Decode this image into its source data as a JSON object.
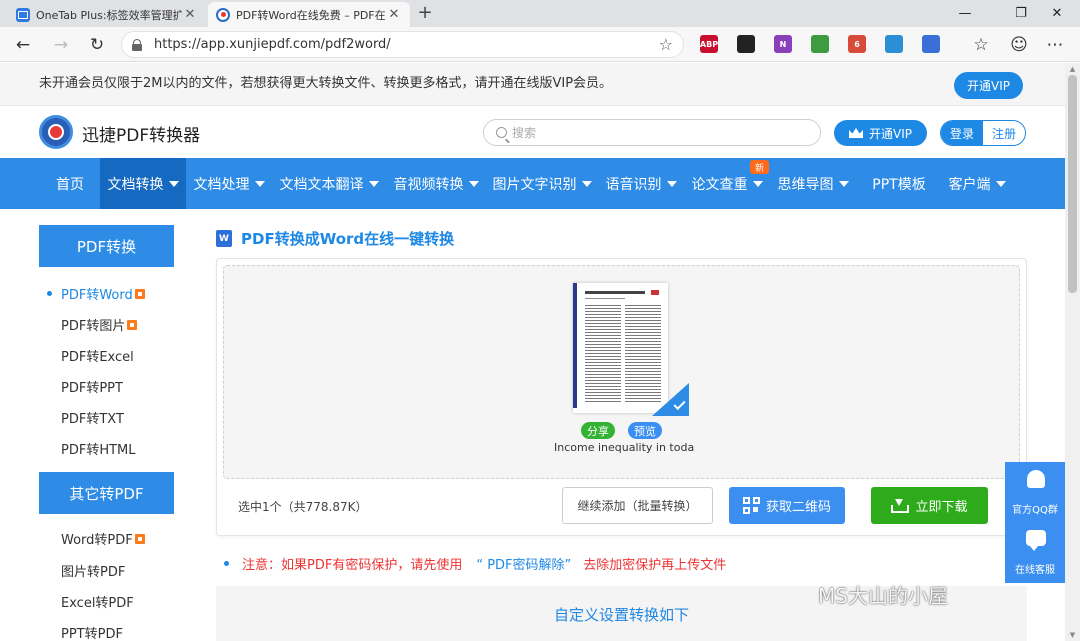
{
  "browser": {
    "tabs": [
      {
        "title": "OneTab Plus:标签效率管理扩展"
      },
      {
        "title": "PDF转Word在线免费 – PDF在线转"
      }
    ],
    "new_tab_symbol": "+",
    "close_symbol": "✕",
    "url": "https://app.xunjiepdf.com/pdf2word/",
    "extensions": [
      {
        "name": "adblock-icon",
        "label": "ABP",
        "color": "#c8102e"
      },
      {
        "name": "tampermonkey-icon",
        "label": "",
        "color": "#222222"
      },
      {
        "name": "onenote-icon",
        "label": "N",
        "color": "#8b3fb8"
      },
      {
        "name": "cube-icon",
        "label": "",
        "color": "#3f9b3f"
      },
      {
        "name": "puzzle-badge-icon",
        "label": "6",
        "color": "#d84a3a"
      },
      {
        "name": "shield-icon",
        "label": "",
        "color": "#2c8fd6"
      },
      {
        "name": "screen-icon",
        "label": "",
        "color": "#3a6fd8"
      }
    ]
  },
  "notice": {
    "text": "未开通会员仅限于2M以内的文件，若想获得更大转换文件、转换更多格式，请开通在线版VIP会员。",
    "vip_button": "开通VIP"
  },
  "header": {
    "brand": "迅捷PDF转换器",
    "search_placeholder": "搜索",
    "vip_button": "开通VIP",
    "login": "登录",
    "register": "注册"
  },
  "nav": {
    "items": [
      {
        "label": "首页",
        "dropdown": false
      },
      {
        "label": "文档转换",
        "dropdown": true
      },
      {
        "label": "文档处理",
        "dropdown": true
      },
      {
        "label": "文档文本翻译",
        "dropdown": true
      },
      {
        "label": "音视频转换",
        "dropdown": true
      },
      {
        "label": "图片文字识别",
        "dropdown": true
      },
      {
        "label": "语音识别",
        "dropdown": true
      },
      {
        "label": "论文查重",
        "dropdown": true
      },
      {
        "label": "思维导图",
        "dropdown": true
      },
      {
        "label": "PPT模板",
        "dropdown": false
      },
      {
        "label": "客户端",
        "dropdown": true
      }
    ],
    "new_badge": "新"
  },
  "sidebar": {
    "section1_title": "PDF转换",
    "section1_items": [
      "PDF转Word",
      "PDF转图片",
      "PDF转Excel",
      "PDF转PPT",
      "PDF转TXT",
      "PDF转HTML"
    ],
    "section2_title": "其它转PDF",
    "section2_items": [
      "Word转PDF",
      "图片转PDF",
      "Excel转PDF",
      "PPT转PDF"
    ]
  },
  "main": {
    "title": "PDF转换成Word在线一键转换",
    "word_icon_label": "W",
    "file": {
      "share": "分享",
      "preview": "预览",
      "name": "Income inequality in toda..."
    },
    "selected_info": "选中1个（共778.87K）",
    "continue_button": "继续添加（批量转换）",
    "qr_button": "获取二维码",
    "download_button": "立即下载",
    "note_prefix": "注意：如果PDF有密码保护，请先使用",
    "note_link": "“ PDF密码解除”",
    "note_suffix": "去除加密保护再上传文件",
    "custom_settings": "自定义设置转换如下"
  },
  "float_service": {
    "qq_group": "官方QQ群",
    "online_service": "在线客服"
  },
  "watermark": "MS大山的小屋",
  "colors": {
    "primary_blue": "#2e8be6",
    "download_green": "#2eab1b",
    "warning_red": "#e33333",
    "badge_orange": "#ff6a1a"
  }
}
